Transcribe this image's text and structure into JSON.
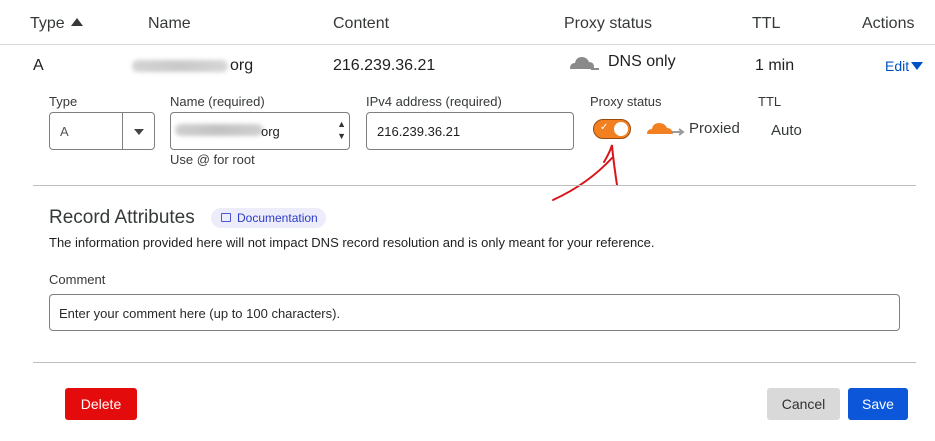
{
  "table": {
    "headers": {
      "type": "Type",
      "name": "Name",
      "content": "Content",
      "proxy_status": "Proxy status",
      "ttl": "TTL",
      "actions": "Actions"
    },
    "row": {
      "type": "A",
      "name_suffix": "org",
      "content": "216.239.36.21",
      "proxy_status": "DNS only",
      "ttl": "1 min",
      "action": "Edit"
    }
  },
  "form": {
    "type_label": "Type",
    "type_value": "A",
    "name_label": "Name (required)",
    "name_value_suffix": "org",
    "name_hint": "Use @ for root",
    "ipv4_label": "IPv4 address (required)",
    "ipv4_value": "216.239.36.21",
    "proxy_label": "Proxy status",
    "proxy_value": "Proxied",
    "ttl_label": "TTL",
    "ttl_value": "Auto"
  },
  "attributes": {
    "title": "Record Attributes",
    "doc_link": "Documentation",
    "description": "The information provided here will not impact DNS record resolution and is only meant for your reference.",
    "comment_label": "Comment",
    "comment_placeholder": "Enter your comment here (up to 100 characters)."
  },
  "buttons": {
    "delete": "Delete",
    "cancel": "Cancel",
    "save": "Save"
  },
  "colors": {
    "proxied_orange": "#f38020",
    "delete_red": "#e30b0b",
    "save_blue": "#0b56d9",
    "link_blue": "#0051c3",
    "annotation_red": "#d9141b"
  },
  "icons": [
    "sort-up-icon",
    "grey-cloud-icon",
    "chevron-down-icon",
    "orange-cloud-icon",
    "documentation-icon",
    "check-icon"
  ]
}
